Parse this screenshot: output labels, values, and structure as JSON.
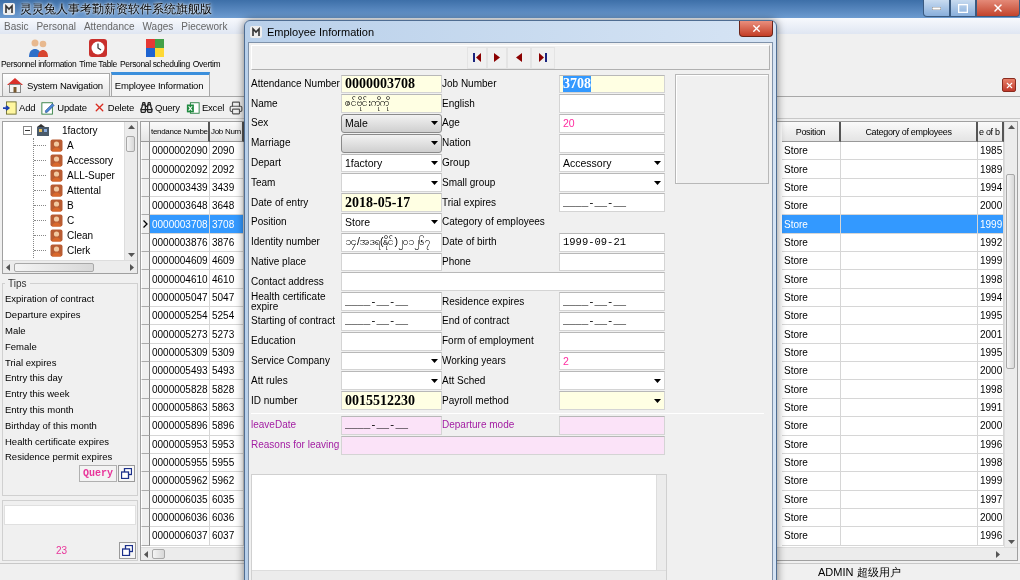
{
  "app": {
    "title": "灵灵兔人事考勤薪资软件系统旗舰版"
  },
  "menu": [
    {
      "label": "Basic"
    },
    {
      "label": "Personal"
    },
    {
      "label": "Attendance"
    },
    {
      "label": "Wages"
    },
    {
      "label": "Piecework"
    }
  ],
  "launchers": [
    {
      "label": "Personnel information"
    },
    {
      "label": "Time Table"
    },
    {
      "label": "Personal scheduling"
    },
    {
      "label": "Overtim"
    }
  ],
  "tabs": [
    {
      "label": "System Navigation",
      "selected": false
    },
    {
      "label": "Employee Information",
      "selected": true
    }
  ],
  "actions": [
    {
      "label": "Add"
    },
    {
      "label": "Update"
    },
    {
      "label": "Delete"
    },
    {
      "label": "Query"
    },
    {
      "label": "Excel"
    }
  ],
  "tree": {
    "label": "1factory",
    "expanded": true,
    "children": [
      {
        "label": "A"
      },
      {
        "label": "Accessory"
      },
      {
        "label": "ALL-Super"
      },
      {
        "label": "Attental"
      },
      {
        "label": "B"
      },
      {
        "label": "C"
      },
      {
        "label": "Clean"
      },
      {
        "label": "Clerk"
      }
    ]
  },
  "tips": {
    "title": "Tips",
    "items": [
      "Expiration of contract",
      "Departure expires",
      "Male",
      "Female",
      "Trial expires",
      "Entry this day",
      "Entry this week",
      "Entry this month",
      "Birthday of this month",
      "Health certificate expires",
      "Residence permit expires"
    ],
    "query_button": "Query"
  },
  "footer": {
    "count": "23"
  },
  "grid": {
    "columns": {
      "attendance_number": "tendance Numbe",
      "job_number": "Job Num",
      "position": "Position",
      "category": "Category of employees",
      "column_5": "e of b"
    },
    "rows": [
      {
        "selected": false,
        "attendance_number": "0000002090",
        "job_number": "2090",
        "position": "Store",
        "column_5": "1985"
      },
      {
        "selected": false,
        "attendance_number": "0000002092",
        "job_number": "2092",
        "position": "Store",
        "column_5": "1989"
      },
      {
        "selected": false,
        "attendance_number": "0000003439",
        "job_number": "3439",
        "position": "Store",
        "column_5": "1994"
      },
      {
        "selected": false,
        "attendance_number": "0000003648",
        "job_number": "3648",
        "position": "Store",
        "column_5": "2000"
      },
      {
        "selected": true,
        "attendance_number": "0000003708",
        "job_number": "3708",
        "position": "Store",
        "column_5": "1999"
      },
      {
        "selected": false,
        "attendance_number": "0000003876",
        "job_number": "3876",
        "position": "Store",
        "column_5": "1992"
      },
      {
        "selected": false,
        "attendance_number": "0000004609",
        "job_number": "4609",
        "position": "Store",
        "column_5": "1999"
      },
      {
        "selected": false,
        "attendance_number": "0000004610",
        "job_number": "4610",
        "position": "Store",
        "column_5": "1998"
      },
      {
        "selected": false,
        "attendance_number": "0000005047",
        "job_number": "5047",
        "position": "Store",
        "column_5": "1994"
      },
      {
        "selected": false,
        "attendance_number": "0000005254",
        "job_number": "5254",
        "position": "Store",
        "column_5": "1995"
      },
      {
        "selected": false,
        "attendance_number": "0000005273",
        "job_number": "5273",
        "position": "Store",
        "column_5": "2001"
      },
      {
        "selected": false,
        "attendance_number": "0000005309",
        "job_number": "5309",
        "position": "Store",
        "column_5": "1995"
      },
      {
        "selected": false,
        "attendance_number": "0000005493",
        "job_number": "5493",
        "position": "Store",
        "column_5": "2000"
      },
      {
        "selected": false,
        "attendance_number": "0000005828",
        "job_number": "5828",
        "position": "Store",
        "column_5": "1998"
      },
      {
        "selected": false,
        "attendance_number": "0000005863",
        "job_number": "5863",
        "position": "Store",
        "column_5": "1991"
      },
      {
        "selected": false,
        "attendance_number": "0000005896",
        "job_number": "5896",
        "position": "Store",
        "column_5": "2000"
      },
      {
        "selected": false,
        "attendance_number": "0000005953",
        "job_number": "5953",
        "position": "Store",
        "column_5": "1996"
      },
      {
        "selected": false,
        "attendance_number": "0000005955",
        "job_number": "5955",
        "position": "Store",
        "column_5": "1998"
      },
      {
        "selected": false,
        "attendance_number": "0000005962",
        "job_number": "5962",
        "position": "Store",
        "column_5": "1999"
      },
      {
        "selected": false,
        "attendance_number": "0000006035",
        "job_number": "6035",
        "position": "Store",
        "column_5": "1997"
      },
      {
        "selected": false,
        "attendance_number": "0000006036",
        "job_number": "6036",
        "position": "Store",
        "column_5": "2000"
      },
      {
        "selected": false,
        "attendance_number": "0000006037",
        "job_number": "6037",
        "position": "Store",
        "column_5": "1996"
      }
    ]
  },
  "status_bar": {
    "user": "ADMIN 超级用户"
  },
  "dialog": {
    "title": "Employee Information",
    "rows": [
      {
        "left": {
          "label": "Attendance Number",
          "kind": "text",
          "value": "0000003708",
          "required": true,
          "large": true
        },
        "right": {
          "label": "Job Number",
          "kind": "text",
          "value": "3708",
          "required": true,
          "large": true,
          "highlighted": true
        }
      },
      {
        "left": {
          "label": "Name",
          "kind": "text",
          "value": "ဇင်ဗိုင်းကိုကို",
          "required": true
        },
        "right": {
          "label": "English",
          "kind": "text"
        }
      },
      {
        "left": {
          "label": "Sex",
          "kind": "select",
          "value": "Male"
        },
        "right": {
          "label": "Age",
          "kind": "text",
          "value": "20",
          "computed": true
        }
      },
      {
        "left": {
          "label": "Marriage",
          "kind": "select"
        },
        "right": {
          "label": "Nation",
          "kind": "text"
        }
      },
      {
        "left": {
          "label": "Depart",
          "kind": "combo",
          "value": "1factory"
        },
        "right": {
          "label": "Group",
          "kind": "combo",
          "value": "Accessory"
        }
      },
      {
        "left": {
          "label": "Team",
          "kind": "combo"
        },
        "right": {
          "label": "Small group",
          "kind": "combo"
        }
      },
      {
        "left": {
          "label": "Date of entry",
          "kind": "date",
          "value": "2018-05-17",
          "required": true,
          "large": true
        },
        "right": {
          "label": "Trial expires",
          "kind": "date",
          "value": "____-__-__"
        }
      },
      {
        "left": {
          "label": "Position",
          "kind": "combo",
          "value": "Store"
        },
        "right": {
          "label": "Category of employees",
          "kind": "none"
        }
      },
      {
        "left": {
          "label": "Identity number",
          "kind": "text",
          "value": "၁၄/အဒရ(နိုင်)၂၀၁၂၆၇"
        },
        "right": {
          "label": "Date of birth",
          "kind": "date",
          "value": "1999-09-21"
        }
      },
      {
        "left": {
          "label": "Native place",
          "kind": "text"
        },
        "right": {
          "label": "Phone",
          "kind": "text"
        }
      },
      {
        "left": {
          "label": "Contact address",
          "kind": "wide"
        }
      },
      {
        "left": {
          "label": "Health certificate expire",
          "kind": "date",
          "value": "____-__-__"
        },
        "right": {
          "label": "Residence expires",
          "kind": "date",
          "value": "____-__-__"
        }
      },
      {
        "left": {
          "label": "Starting of contract",
          "kind": "date",
          "value": "____-__-__"
        },
        "right": {
          "label": "End of contract",
          "kind": "date",
          "value": "____-__-__"
        }
      },
      {
        "left": {
          "label": "Education",
          "kind": "text"
        },
        "right": {
          "label": "Form of employment",
          "kind": "text"
        }
      },
      {
        "left": {
          "label": "Service Company",
          "kind": "combo"
        },
        "right": {
          "label": "Working years",
          "kind": "text",
          "value": "2",
          "computed": true
        }
      },
      {
        "left": {
          "label": "Att rules",
          "kind": "combo"
        },
        "right": {
          "label": "Att Sched",
          "kind": "combo"
        }
      },
      {
        "left": {
          "label": "ID number",
          "kind": "text",
          "value": "0015512230",
          "required": true,
          "large": true
        },
        "right": {
          "label": "Payroll method",
          "kind": "combo",
          "required": true
        }
      }
    ],
    "leave_rows": [
      {
        "left": {
          "label": "leaveDate",
          "kind": "date",
          "value": "____-__-__"
        },
        "right": {
          "label": "Departure mode",
          "kind": "text"
        }
      },
      {
        "left": {
          "label": "Reasons for leaving",
          "kind": "wide"
        }
      }
    ]
  }
}
